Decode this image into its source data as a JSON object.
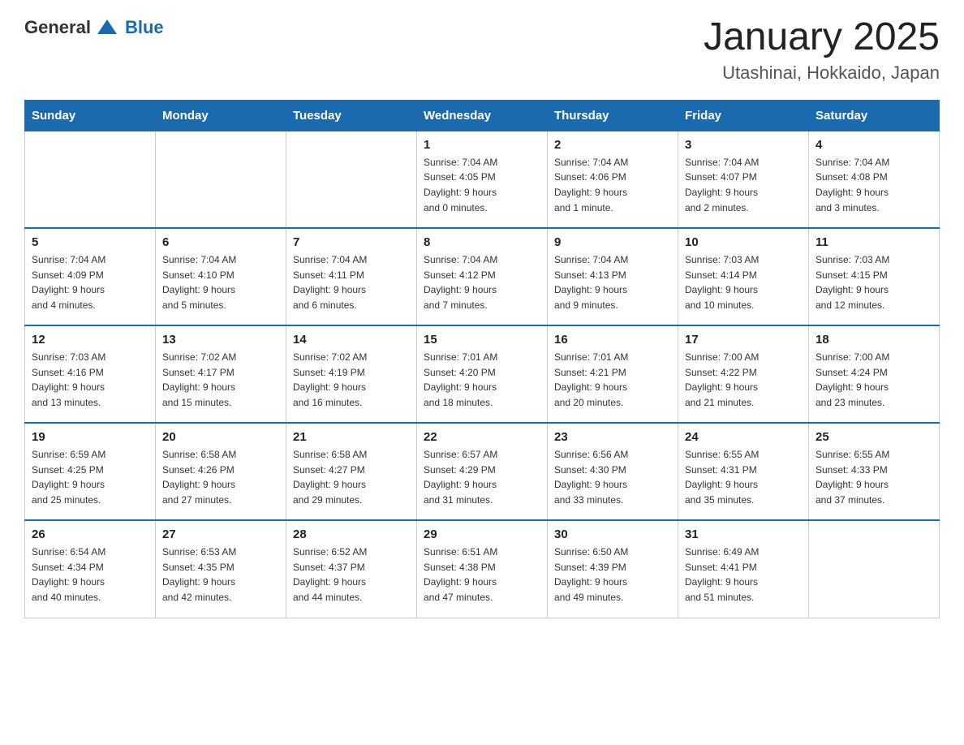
{
  "header": {
    "logo_general": "General",
    "logo_blue": "Blue",
    "title": "January 2025",
    "subtitle": "Utashinai, Hokkaido, Japan"
  },
  "days_of_week": [
    "Sunday",
    "Monday",
    "Tuesday",
    "Wednesday",
    "Thursday",
    "Friday",
    "Saturday"
  ],
  "weeks": [
    [
      {
        "day": "",
        "info": ""
      },
      {
        "day": "",
        "info": ""
      },
      {
        "day": "",
        "info": ""
      },
      {
        "day": "1",
        "info": "Sunrise: 7:04 AM\nSunset: 4:05 PM\nDaylight: 9 hours\nand 0 minutes."
      },
      {
        "day": "2",
        "info": "Sunrise: 7:04 AM\nSunset: 4:06 PM\nDaylight: 9 hours\nand 1 minute."
      },
      {
        "day": "3",
        "info": "Sunrise: 7:04 AM\nSunset: 4:07 PM\nDaylight: 9 hours\nand 2 minutes."
      },
      {
        "day": "4",
        "info": "Sunrise: 7:04 AM\nSunset: 4:08 PM\nDaylight: 9 hours\nand 3 minutes."
      }
    ],
    [
      {
        "day": "5",
        "info": "Sunrise: 7:04 AM\nSunset: 4:09 PM\nDaylight: 9 hours\nand 4 minutes."
      },
      {
        "day": "6",
        "info": "Sunrise: 7:04 AM\nSunset: 4:10 PM\nDaylight: 9 hours\nand 5 minutes."
      },
      {
        "day": "7",
        "info": "Sunrise: 7:04 AM\nSunset: 4:11 PM\nDaylight: 9 hours\nand 6 minutes."
      },
      {
        "day": "8",
        "info": "Sunrise: 7:04 AM\nSunset: 4:12 PM\nDaylight: 9 hours\nand 7 minutes."
      },
      {
        "day": "9",
        "info": "Sunrise: 7:04 AM\nSunset: 4:13 PM\nDaylight: 9 hours\nand 9 minutes."
      },
      {
        "day": "10",
        "info": "Sunrise: 7:03 AM\nSunset: 4:14 PM\nDaylight: 9 hours\nand 10 minutes."
      },
      {
        "day": "11",
        "info": "Sunrise: 7:03 AM\nSunset: 4:15 PM\nDaylight: 9 hours\nand 12 minutes."
      }
    ],
    [
      {
        "day": "12",
        "info": "Sunrise: 7:03 AM\nSunset: 4:16 PM\nDaylight: 9 hours\nand 13 minutes."
      },
      {
        "day": "13",
        "info": "Sunrise: 7:02 AM\nSunset: 4:17 PM\nDaylight: 9 hours\nand 15 minutes."
      },
      {
        "day": "14",
        "info": "Sunrise: 7:02 AM\nSunset: 4:19 PM\nDaylight: 9 hours\nand 16 minutes."
      },
      {
        "day": "15",
        "info": "Sunrise: 7:01 AM\nSunset: 4:20 PM\nDaylight: 9 hours\nand 18 minutes."
      },
      {
        "day": "16",
        "info": "Sunrise: 7:01 AM\nSunset: 4:21 PM\nDaylight: 9 hours\nand 20 minutes."
      },
      {
        "day": "17",
        "info": "Sunrise: 7:00 AM\nSunset: 4:22 PM\nDaylight: 9 hours\nand 21 minutes."
      },
      {
        "day": "18",
        "info": "Sunrise: 7:00 AM\nSunset: 4:24 PM\nDaylight: 9 hours\nand 23 minutes."
      }
    ],
    [
      {
        "day": "19",
        "info": "Sunrise: 6:59 AM\nSunset: 4:25 PM\nDaylight: 9 hours\nand 25 minutes."
      },
      {
        "day": "20",
        "info": "Sunrise: 6:58 AM\nSunset: 4:26 PM\nDaylight: 9 hours\nand 27 minutes."
      },
      {
        "day": "21",
        "info": "Sunrise: 6:58 AM\nSunset: 4:27 PM\nDaylight: 9 hours\nand 29 minutes."
      },
      {
        "day": "22",
        "info": "Sunrise: 6:57 AM\nSunset: 4:29 PM\nDaylight: 9 hours\nand 31 minutes."
      },
      {
        "day": "23",
        "info": "Sunrise: 6:56 AM\nSunset: 4:30 PM\nDaylight: 9 hours\nand 33 minutes."
      },
      {
        "day": "24",
        "info": "Sunrise: 6:55 AM\nSunset: 4:31 PM\nDaylight: 9 hours\nand 35 minutes."
      },
      {
        "day": "25",
        "info": "Sunrise: 6:55 AM\nSunset: 4:33 PM\nDaylight: 9 hours\nand 37 minutes."
      }
    ],
    [
      {
        "day": "26",
        "info": "Sunrise: 6:54 AM\nSunset: 4:34 PM\nDaylight: 9 hours\nand 40 minutes."
      },
      {
        "day": "27",
        "info": "Sunrise: 6:53 AM\nSunset: 4:35 PM\nDaylight: 9 hours\nand 42 minutes."
      },
      {
        "day": "28",
        "info": "Sunrise: 6:52 AM\nSunset: 4:37 PM\nDaylight: 9 hours\nand 44 minutes."
      },
      {
        "day": "29",
        "info": "Sunrise: 6:51 AM\nSunset: 4:38 PM\nDaylight: 9 hours\nand 47 minutes."
      },
      {
        "day": "30",
        "info": "Sunrise: 6:50 AM\nSunset: 4:39 PM\nDaylight: 9 hours\nand 49 minutes."
      },
      {
        "day": "31",
        "info": "Sunrise: 6:49 AM\nSunset: 4:41 PM\nDaylight: 9 hours\nand 51 minutes."
      },
      {
        "day": "",
        "info": ""
      }
    ]
  ]
}
